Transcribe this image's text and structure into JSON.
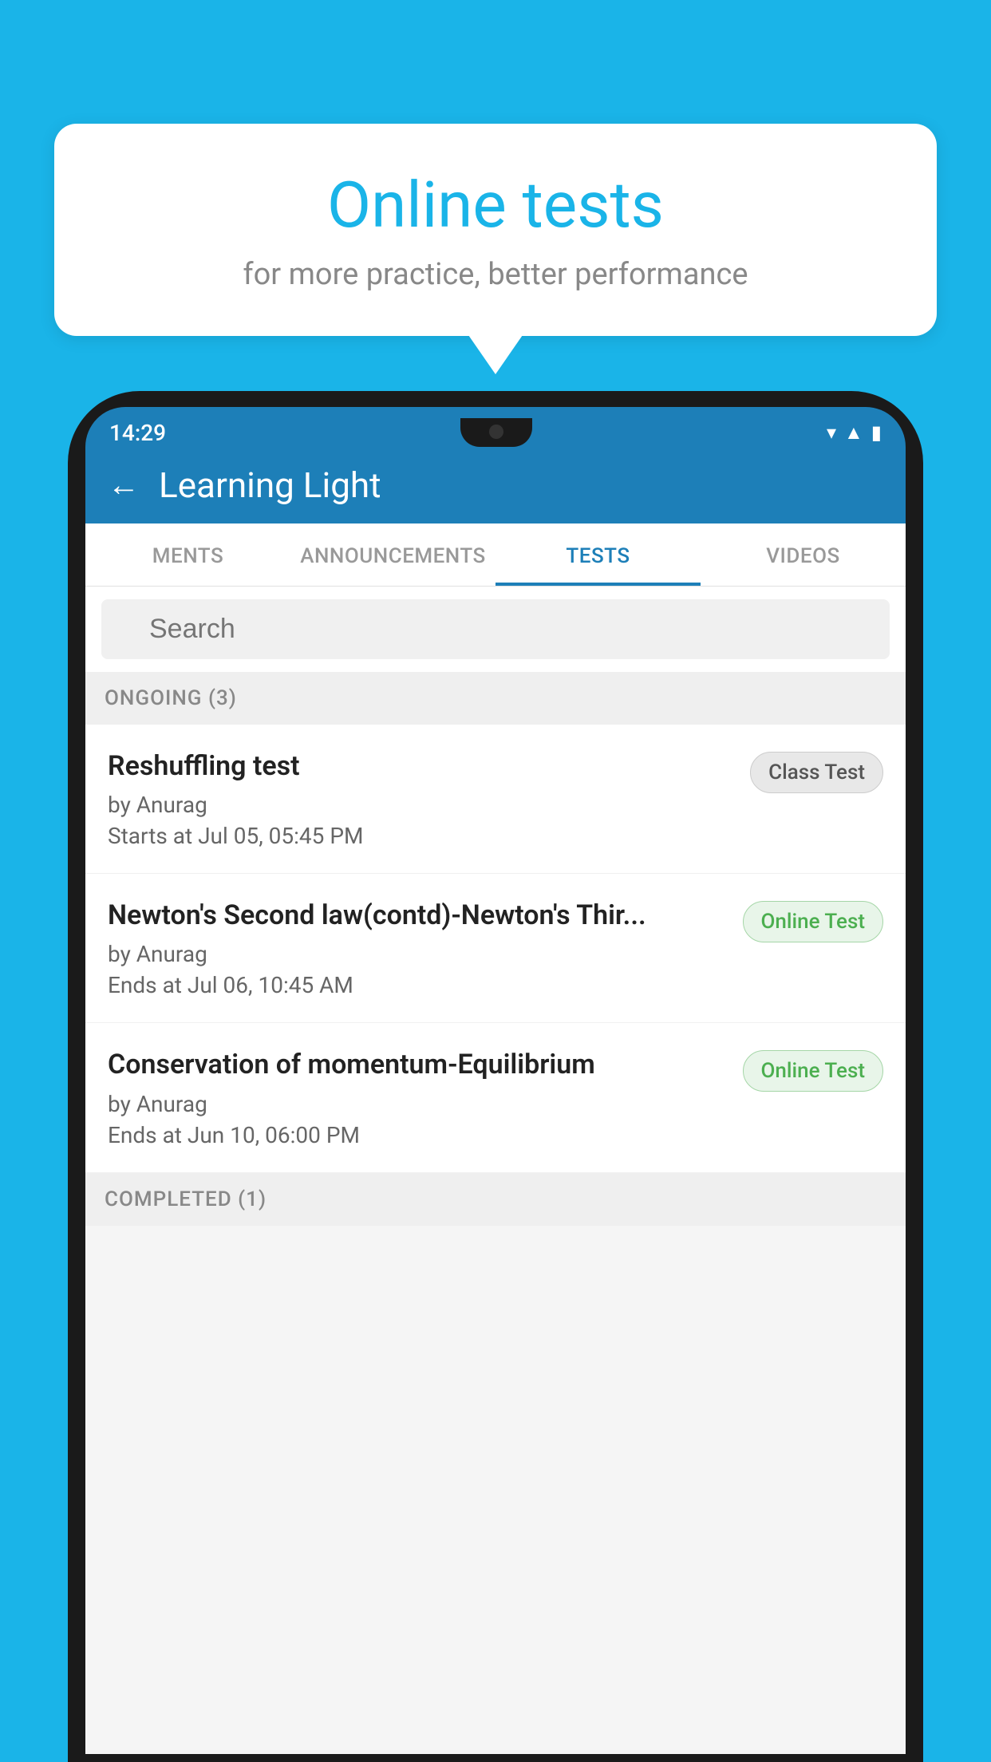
{
  "background_color": "#1ab4e8",
  "bubble": {
    "title": "Online tests",
    "subtitle": "for more practice, better performance"
  },
  "phone": {
    "time": "14:29",
    "status_icons": [
      "wifi",
      "signal",
      "battery"
    ]
  },
  "app": {
    "title": "Learning Light",
    "back_label": "←"
  },
  "tabs": [
    {
      "label": "MENTS",
      "active": false
    },
    {
      "label": "ANNOUNCEMENTS",
      "active": false
    },
    {
      "label": "TESTS",
      "active": true
    },
    {
      "label": "VIDEOS",
      "active": false
    }
  ],
  "search": {
    "placeholder": "Search"
  },
  "ongoing_section": {
    "label": "ONGOING (3)"
  },
  "tests": [
    {
      "name": "Reshuffling test",
      "author": "by Anurag",
      "time_label": "Starts at",
      "time": "Jul 05, 05:45 PM",
      "badge": "Class Test",
      "badge_type": "class"
    },
    {
      "name": "Newton's Second law(contd)-Newton's Thir...",
      "author": "by Anurag",
      "time_label": "Ends at",
      "time": "Jul 06, 10:45 AM",
      "badge": "Online Test",
      "badge_type": "online"
    },
    {
      "name": "Conservation of momentum-Equilibrium",
      "author": "by Anurag",
      "time_label": "Ends at",
      "time": "Jun 10, 06:00 PM",
      "badge": "Online Test",
      "badge_type": "online"
    }
  ],
  "completed_section": {
    "label": "COMPLETED (1)"
  }
}
